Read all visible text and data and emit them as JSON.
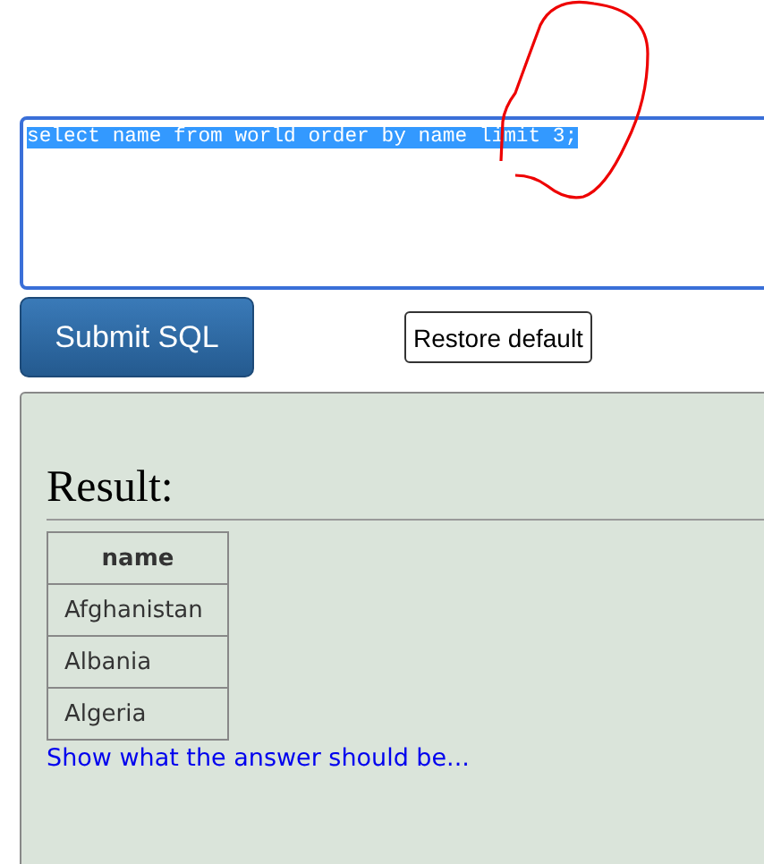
{
  "query_field": {
    "value": "select name from world order by name limit 3;",
    "selected": true
  },
  "buttons": [
    {
      "label": "Submit SQL",
      "kind": "primary"
    },
    {
      "label": "Restore default",
      "kind": "plain"
    }
  ],
  "result": {
    "heading": "Result:",
    "table": {
      "columns": [
        "name"
      ],
      "rows": [
        [
          "Afghanistan"
        ],
        [
          "Albania"
        ],
        [
          "Algeria"
        ]
      ]
    },
    "link": "Show what the answer should be..."
  }
}
